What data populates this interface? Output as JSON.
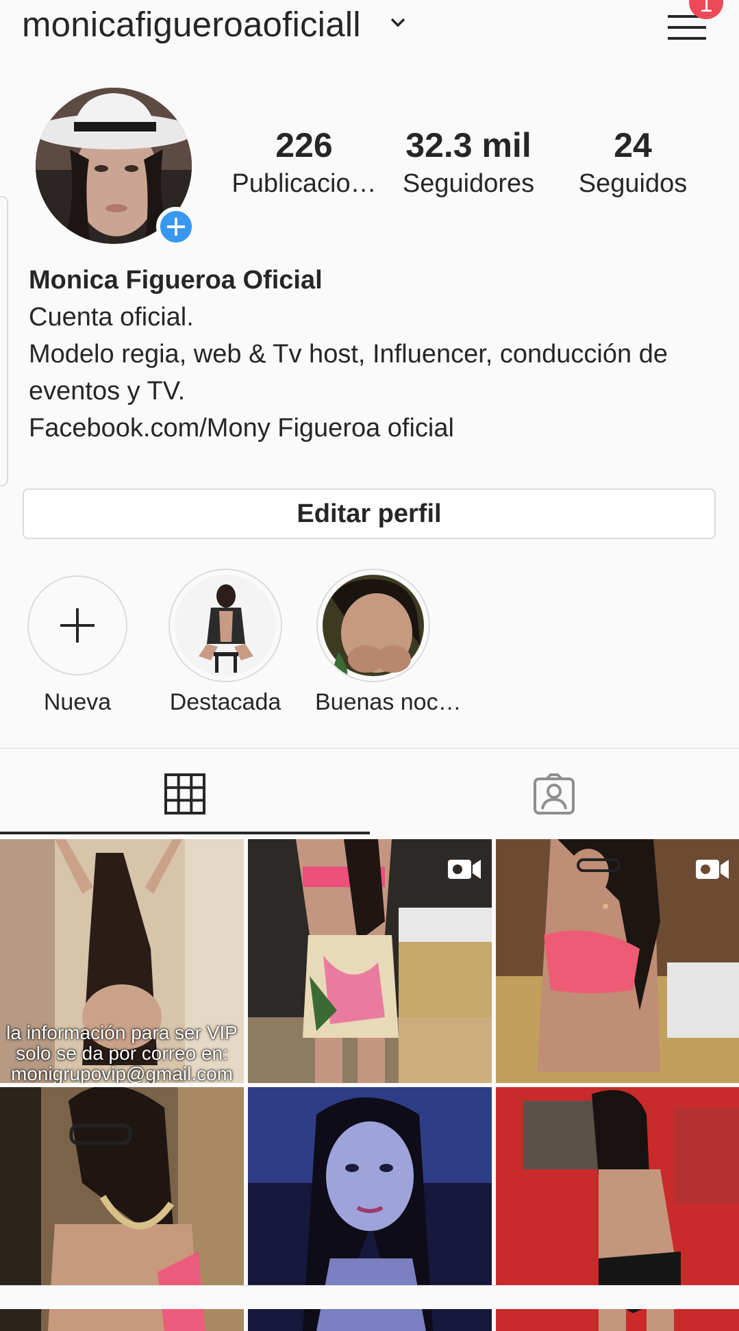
{
  "header": {
    "username": "monicafigueroaoficiall",
    "notification_count": "1"
  },
  "stats": [
    {
      "value": "226",
      "label": "Publicacio…"
    },
    {
      "value": "32.3 mil",
      "label": "Seguidores"
    },
    {
      "value": "24",
      "label": "Seguidos"
    }
  ],
  "bio": {
    "name": "Monica Figueroa Oficial",
    "lines": [
      "Cuenta oficial.",
      "Modelo regia, web & Tv host, Influencer, conducción de",
      "eventos y TV.",
      "Facebook.com/Mony Figueroa oficial"
    ]
  },
  "edit_profile_label": "Editar perfil",
  "highlights": [
    {
      "label": "Nueva"
    },
    {
      "label": "Destacada"
    },
    {
      "label": "Buenas noc…"
    }
  ],
  "posts": [
    {
      "caption": [
        "la información para ser VIP",
        "solo se da por correo en:",
        "monigrupovip@gmail.com"
      ],
      "video": false
    },
    {
      "caption": [],
      "video": true
    },
    {
      "caption": [],
      "video": true
    },
    {
      "caption": [],
      "video": false
    },
    {
      "caption": [],
      "video": false
    },
    {
      "caption": [],
      "video": false
    }
  ],
  "colors": {
    "accent": "#3897f0",
    "badge": "#ed4956",
    "text": "#262626",
    "border": "#dbdbdb"
  }
}
